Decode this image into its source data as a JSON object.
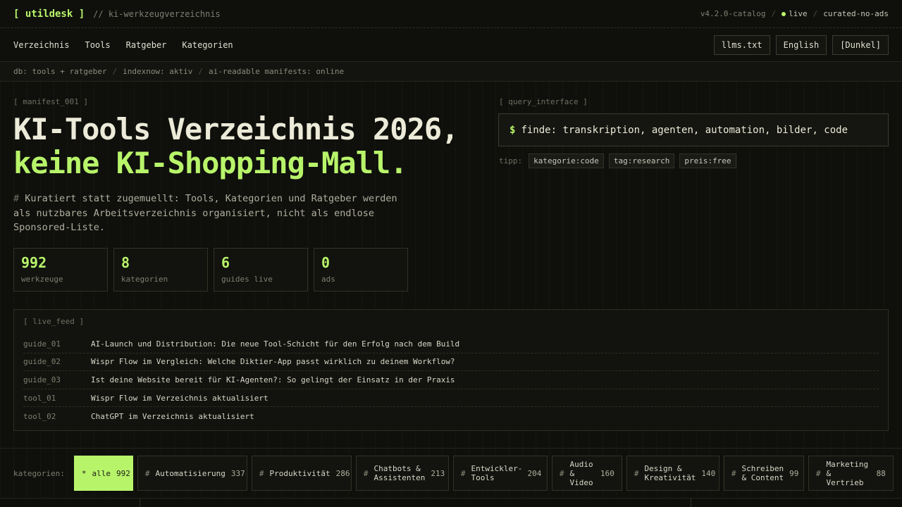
{
  "topbar": {
    "logo": "[ utildesk ]",
    "subtitle": "// ki-werkzeugverzeichnis",
    "version": "v4.2.0-catalog",
    "live": "live",
    "curated": "curated-no-ads"
  },
  "nav": {
    "links": [
      "Verzeichnis",
      "Tools",
      "Ratgeber",
      "Kategorien"
    ],
    "llms": "llms.txt",
    "language": "English",
    "theme": "[Dunkel]"
  },
  "dbstrip": {
    "items": [
      "db: tools + ratgeber",
      "indexnow: aktiv",
      "ai-readable manifests: online"
    ]
  },
  "hero": {
    "manifest_label": "[ manifest_001 ]",
    "title_line1": "KI-Tools Verzeichnis 2026,",
    "title_line2": "keine KI-Shopping-Mall.",
    "hash": "#",
    "description": "Kuratiert statt zugemuellt: Tools, Kategorien und Ratgeber werden als nutzbares Arbeitsverzeichnis organisiert, nicht als endlose Sponsored-Liste."
  },
  "stats": [
    {
      "value": "992",
      "label": "werkzeuge"
    },
    {
      "value": "8",
      "label": "kategorien"
    },
    {
      "value": "6",
      "label": "guides live"
    },
    {
      "value": "0",
      "label": "ads"
    }
  ],
  "query": {
    "label": "[ query_interface ]",
    "prompt": "$",
    "text": "finde: transkription, agenten, automation, bilder, code",
    "tip_label": "tipp:",
    "tips": [
      "kategorie:code",
      "tag:research",
      "preis:free"
    ]
  },
  "feed": {
    "label": "[ live_feed ]",
    "rows": [
      {
        "id": "guide_01",
        "title": "AI-Launch und Distribution: Die neue Tool-Schicht für den Erfolg nach dem Build"
      },
      {
        "id": "guide_02",
        "title": "Wispr Flow im Vergleich: Welche Diktier-App passt wirklich zu deinem Workflow?"
      },
      {
        "id": "guide_03",
        "title": "Ist deine Website bereit für KI-Agenten?: So gelingt der Einsatz in der Praxis"
      },
      {
        "id": "tool_01",
        "title": "Wispr Flow im Verzeichnis aktualisiert"
      },
      {
        "id": "tool_02",
        "title": "ChatGPT im Verzeichnis aktualisiert"
      }
    ]
  },
  "categories": {
    "label": "kategorien:",
    "items": [
      {
        "hash": "*",
        "name": "alle",
        "count": "992"
      },
      {
        "hash": "#",
        "name": "Automatisierung",
        "count": "337"
      },
      {
        "hash": "#",
        "name": "Produktivität",
        "count": "286"
      },
      {
        "hash": "#",
        "name": "Chatbots & Assistenten",
        "count": "213"
      },
      {
        "hash": "#",
        "name": "Entwickler-Tools",
        "count": "204"
      },
      {
        "hash": "#",
        "name": "Audio & Video",
        "count": "160"
      },
      {
        "hash": "#",
        "name": "Design & Kreativität",
        "count": "140"
      },
      {
        "hash": "#",
        "name": "Schreiben & Content",
        "count": "99"
      },
      {
        "hash": "#",
        "name": "Marketing & Vertrieb",
        "count": "88"
      }
    ]
  },
  "colors": {
    "accent": "#b8f46a",
    "background": "#0f100c"
  }
}
